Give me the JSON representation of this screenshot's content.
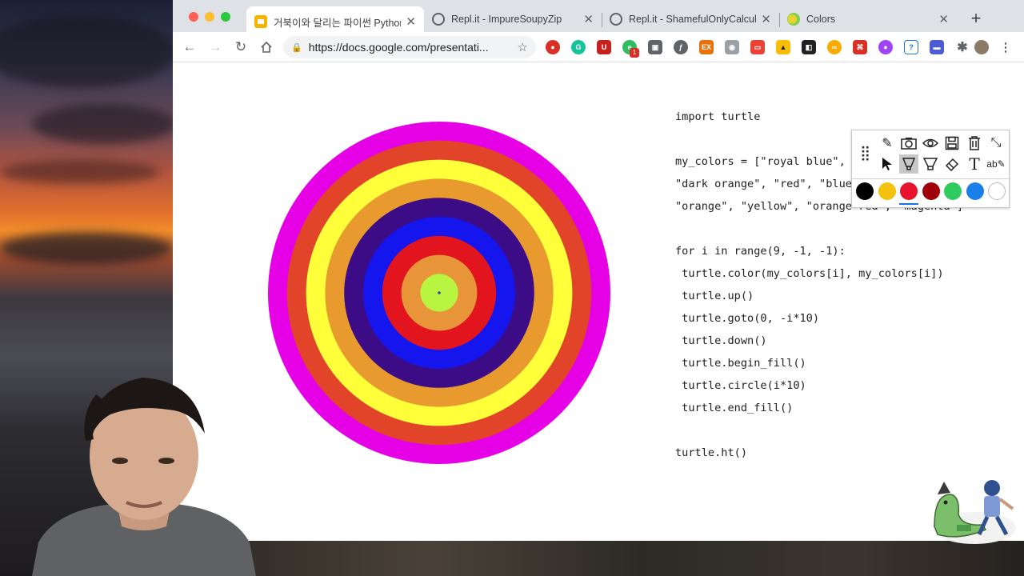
{
  "browser": {
    "tabs": [
      {
        "title": "거북이와 달리는 파이썬 Python w",
        "icon": "google-slides-icon",
        "active": true
      },
      {
        "title": "Repl.it - ImpureSoupyZip",
        "icon": "replit-icon",
        "active": false
      },
      {
        "title": "Repl.it - ShamefulOnlyCalcul",
        "icon": "replit-icon",
        "active": false
      },
      {
        "title": "Colors",
        "icon": "colors-icon",
        "active": false
      }
    ],
    "new_tab_label": "+",
    "address": {
      "url": "https://docs.google.com/presentati..."
    },
    "extension_badge": "1"
  },
  "slide": {
    "code_lines": [
      "import turtle",
      "",
      "my_colors = [\"royal blue\", \"green yellow\",",
      "\"dark orange\", \"red\", \"blue\", \"indigo\",",
      "\"orange\", \"yellow\", \"orange red\", \"magenta\"]",
      "",
      "for i in range(9, -1, -1):",
      " turtle.color(my_colors[i], my_colors[i])",
      " turtle.up()",
      " turtle.goto(0, -i*10)",
      " turtle.down()",
      " turtle.begin_fill()",
      " turtle.circle(i*10)",
      " turtle.end_fill()",
      "",
      "turtle.ht()"
    ],
    "rings": [
      {
        "color": "#e600e6"
      },
      {
        "color": "#e2442a"
      },
      {
        "color": "#ffff3a"
      },
      {
        "color": "#e89a2e"
      },
      {
        "color": "#3b0c86"
      },
      {
        "color": "#1515ee"
      },
      {
        "color": "#e2141e"
      },
      {
        "color": "#e8953a"
      },
      {
        "color": "#b8f541"
      }
    ]
  },
  "annotation_toolbar": {
    "colors": [
      "#000000",
      "#f4c20d",
      "#e8132c",
      "#a0000a",
      "#2ecc5f",
      "#1a7fe8",
      "#ffffff"
    ],
    "selected_color_index": 2
  }
}
